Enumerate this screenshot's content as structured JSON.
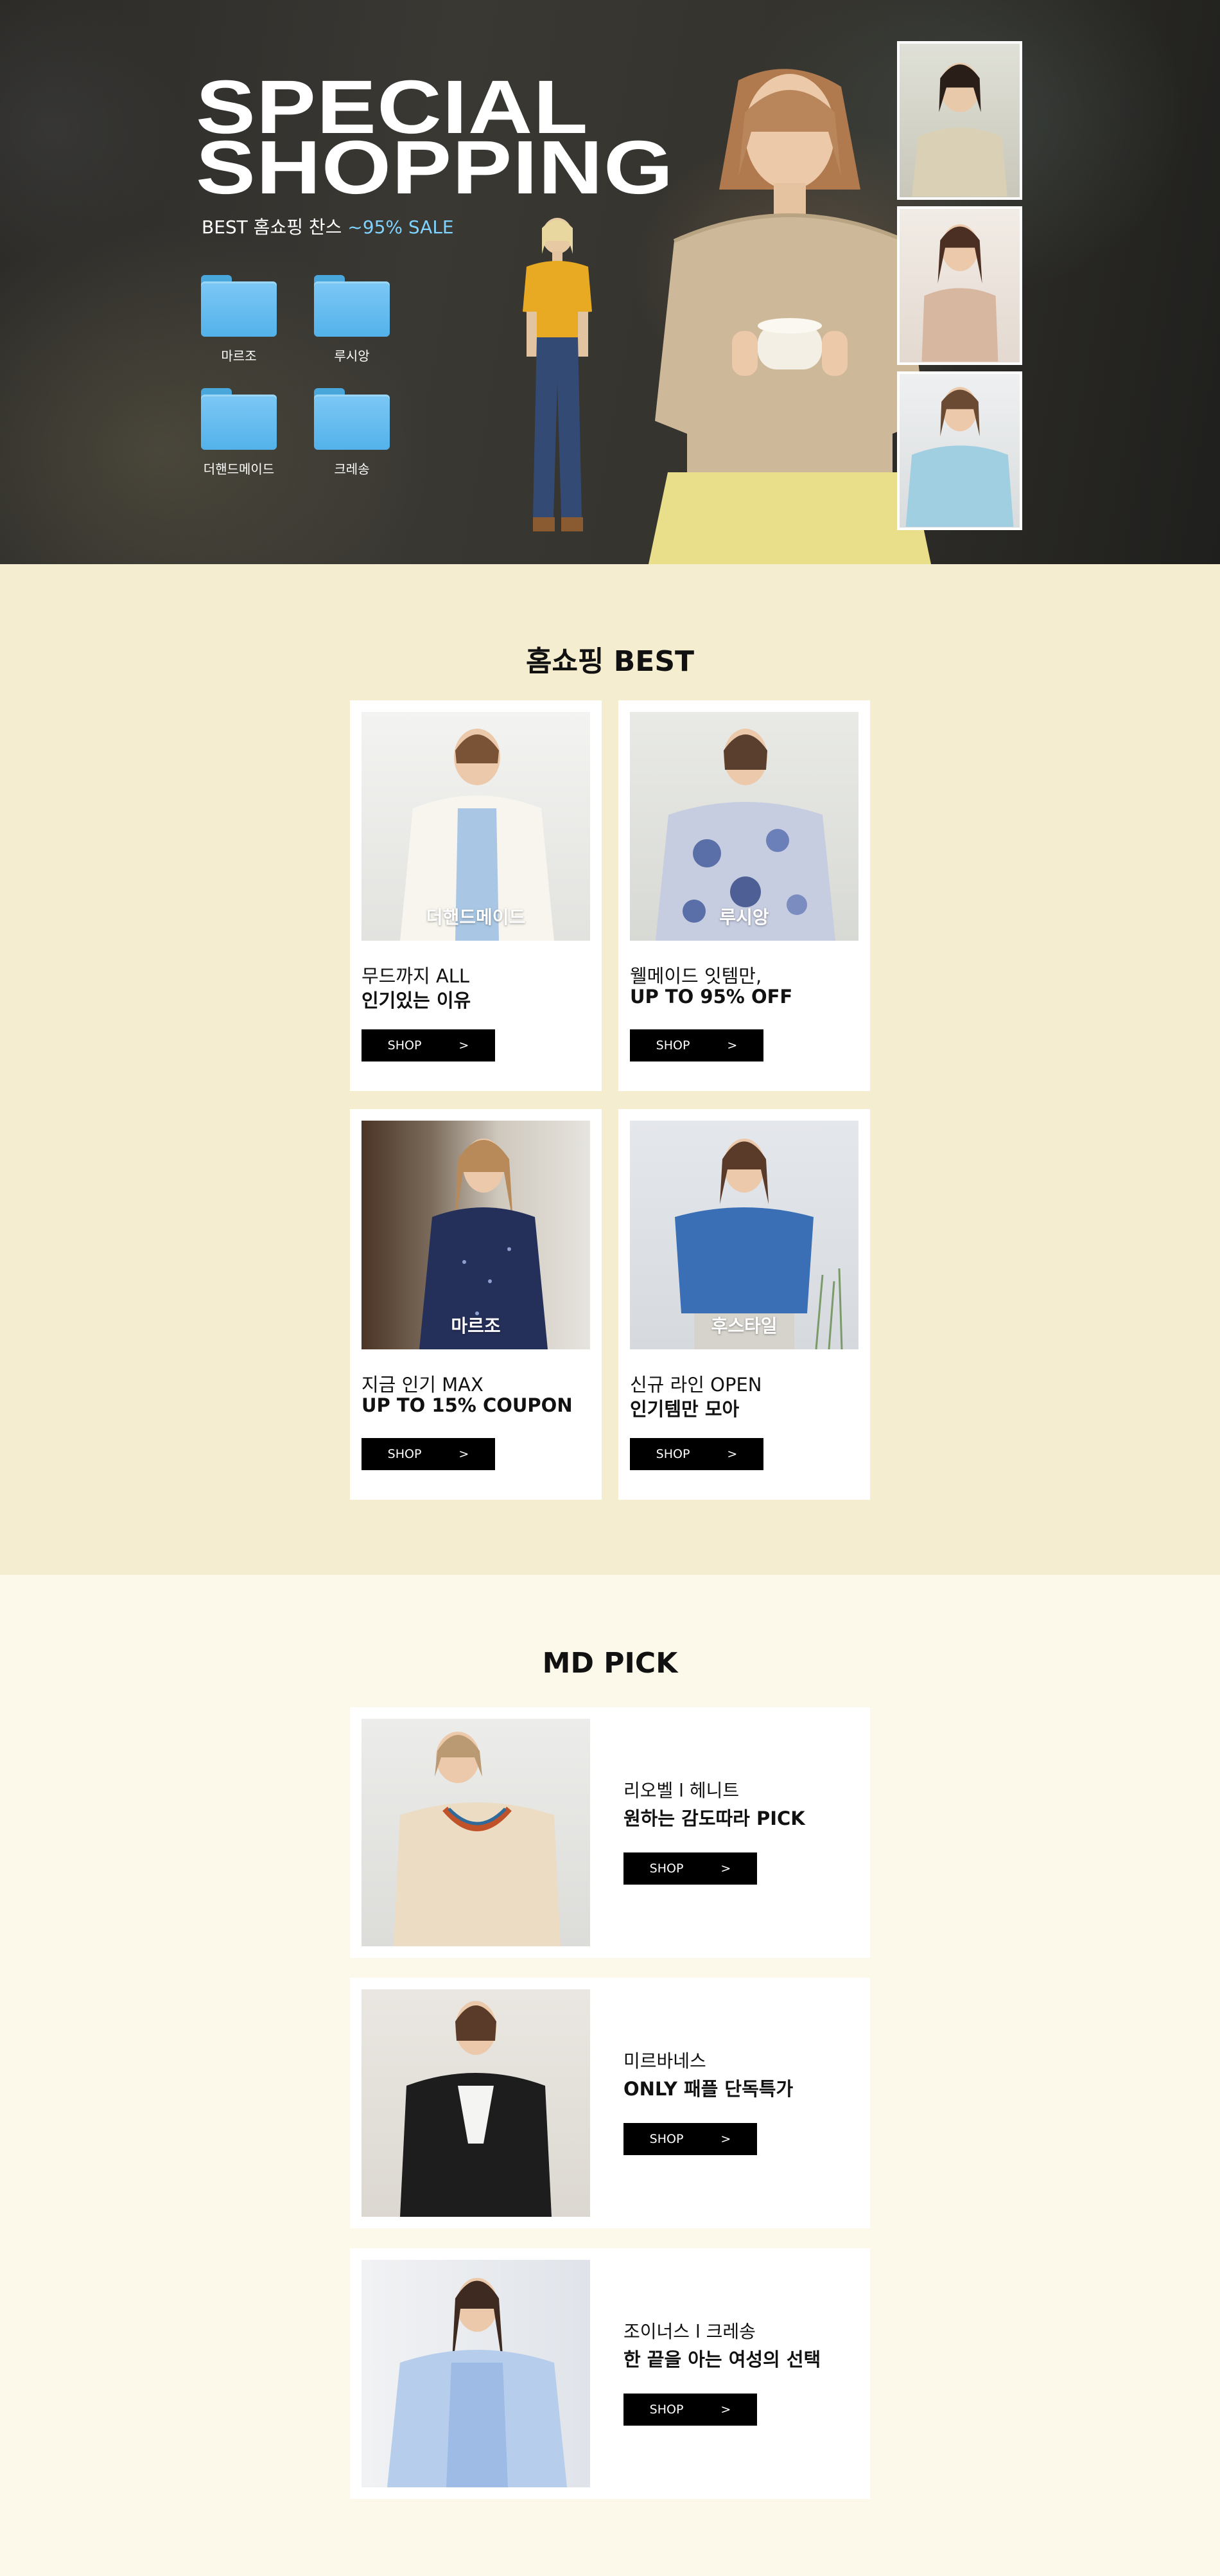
{
  "hero": {
    "title_line1": "SPECIAL",
    "title_line2": "SHOPPING",
    "subtitle_prefix": "BEST 홈쇼핑 찬스",
    "subtitle_highlight": " ~95% SALE",
    "folders": [
      {
        "label": "마르조",
        "icon": "folder-icon"
      },
      {
        "label": "루시앙",
        "icon": "folder-icon"
      },
      {
        "label": "더핸드메이드",
        "icon": "folder-icon"
      },
      {
        "label": "크레송",
        "icon": "folder-icon"
      }
    ],
    "highlight_color": "#7fd3ff"
  },
  "best": {
    "title": "홈쇼핑 BEST",
    "cards": [
      {
        "brand": "더핸드메이드",
        "line1": "무드까지 ALL",
        "line2": "인기있는 이유",
        "button": "SHOP",
        "arrow": ">"
      },
      {
        "brand": "루시앙",
        "line1": "웰메이드 잇템만,",
        "line2": "UP TO 95% OFF",
        "button": "SHOP",
        "arrow": ">"
      },
      {
        "brand": "마르조",
        "line1": "지금 인기 MAX",
        "line2": "UP TO 15% COUPON",
        "button": "SHOP",
        "arrow": ">"
      },
      {
        "brand": "후스타일",
        "line1": "신규 라인 OPEN",
        "line2": "인기템만 모아",
        "button": "SHOP",
        "arrow": ">"
      }
    ],
    "background": "#f5edcf"
  },
  "mdpick": {
    "title": "MD PICK",
    "items": [
      {
        "line1": "리오벨 l 헤니트",
        "line2": "원하는 감도따라 PICK",
        "button": "SHOP",
        "arrow": ">"
      },
      {
        "line1": "미르바네스",
        "line2": "ONLY 패플 단독특가",
        "button": "SHOP",
        "arrow": ">"
      },
      {
        "line1": "조이너스 l 크레송",
        "line2": "한 끝을 아는 여성의 선택",
        "button": "SHOP",
        "arrow": ">"
      }
    ],
    "background": "#fdf9ea"
  }
}
